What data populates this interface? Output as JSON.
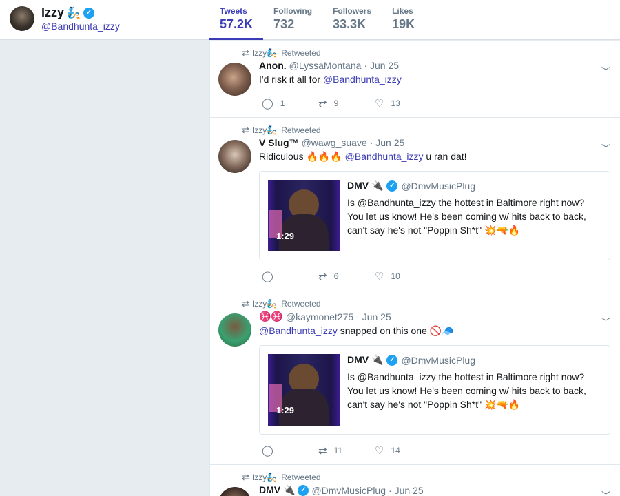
{
  "profile": {
    "name": "Izzy",
    "handle": "@Bandhunta_izzy",
    "name_emoji": "🧞"
  },
  "stats": [
    {
      "label": "Tweets",
      "value": "57.2K",
      "active": true
    },
    {
      "label": "Following",
      "value": "732",
      "active": false
    },
    {
      "label": "Followers",
      "value": "33.3K",
      "active": false
    },
    {
      "label": "Likes",
      "value": "19K",
      "active": false
    }
  ],
  "retweet_label": "Retweeted",
  "retweeter_name": "Izzy🧞",
  "tweets": [
    {
      "name": "Anon.",
      "handle": "@LyssaMontana",
      "date": "· Jun 25",
      "text_prefix": "I'd risk it all for ",
      "mention": "@Bandhunta_izzy",
      "text_suffix": "",
      "replies": "1",
      "retweets": "9",
      "likes": "13"
    },
    {
      "name": "V Slug™",
      "handle": "@wawg_suave",
      "date": "· Jun 25",
      "text_prefix": "Ridiculous 🔥🔥🔥 ",
      "mention": "@Bandhunta_izzy",
      "text_suffix": " u ran dat!",
      "replies": "",
      "retweets": "6",
      "likes": "10"
    },
    {
      "name": "♓♓",
      "handle": "@kaymonet275",
      "date": "· Jun 25",
      "text_prefix": "",
      "mention": "@Bandhunta_izzy",
      "text_suffix": " snapped on this one 🚫🧢",
      "replies": "",
      "retweets": "11",
      "likes": "14"
    },
    {
      "name": "DMV 🔌",
      "handle": "@DmvMusicPlug",
      "date": "· Jun 25"
    }
  ],
  "quote": {
    "name": "DMV 🔌",
    "handle": "@DmvMusicPlug",
    "line1": "Is @Bandhunta_izzy the hottest in Baltimore right now?",
    "line2": "You let us know! He's been coming w/ hits back to back,",
    "line3": "can't say he's not \"Poppin Sh*t\" 💥🔫🔥",
    "duration": "1:29"
  },
  "icons": {
    "chevron": "chevron-down-icon",
    "reply": "reply-icon",
    "retweet": "retweet-icon",
    "like": "heart-icon",
    "verified": "verified-badge-icon"
  },
  "colors": {
    "accent": "#3b3bb7",
    "verified": "#1da1f2",
    "muted": "#657786",
    "background": "#e6ecf0"
  }
}
